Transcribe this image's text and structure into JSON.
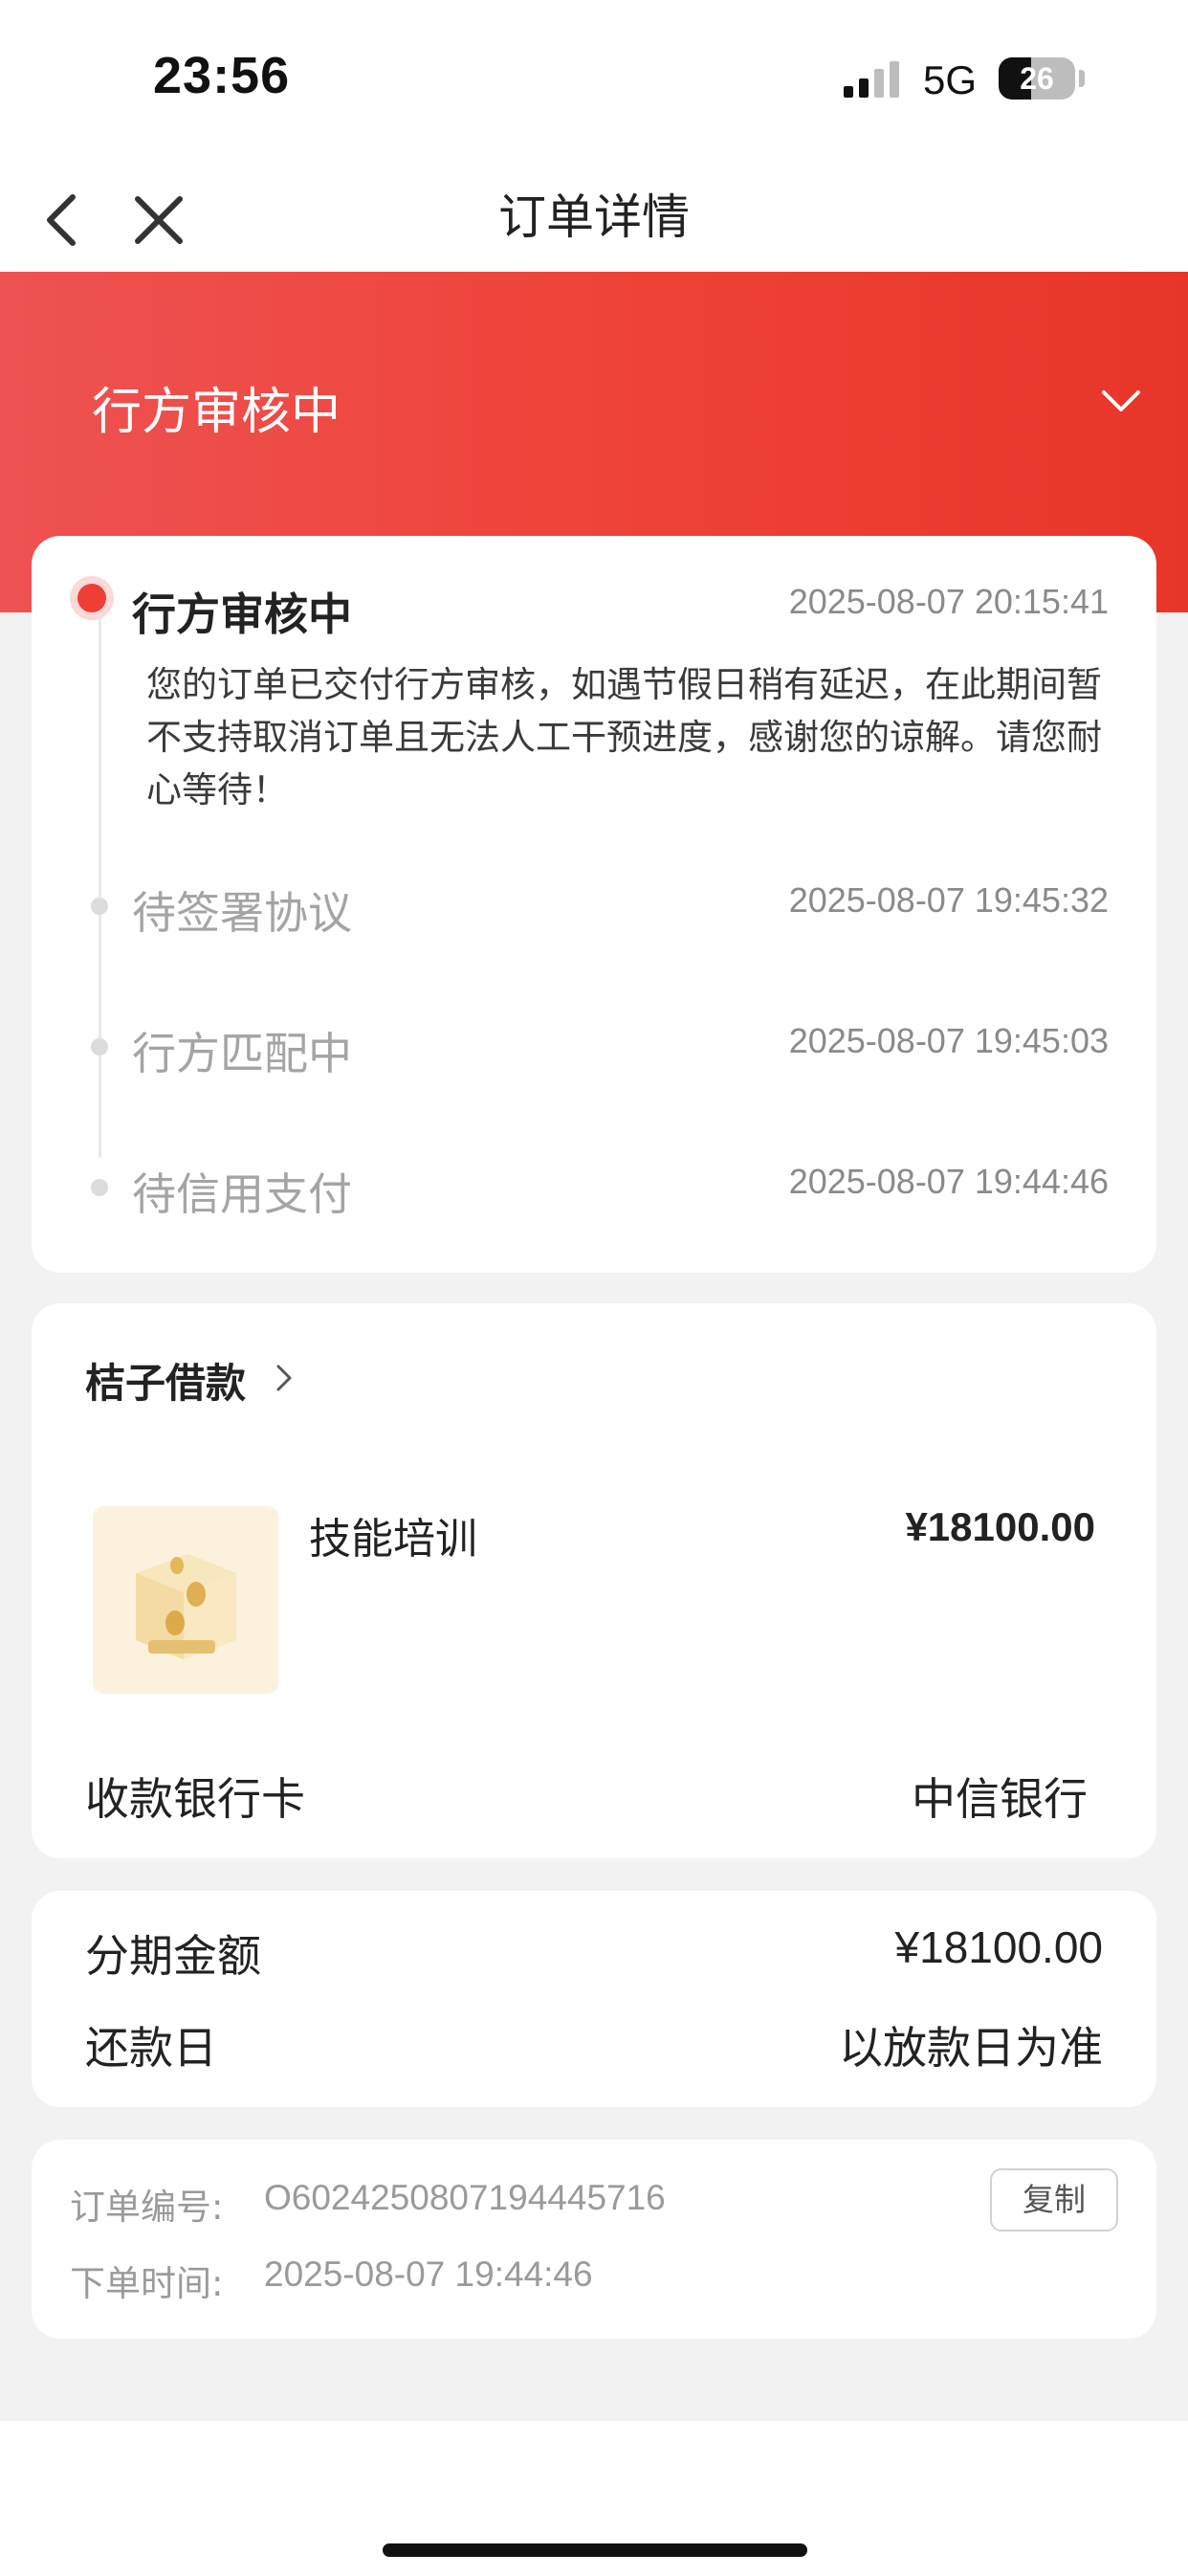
{
  "status_bar": {
    "time": "23:56",
    "network": "5G",
    "battery": "26"
  },
  "nav": {
    "title": "订单详情"
  },
  "banner": {
    "status": "行方审核中"
  },
  "timeline": {
    "steps": [
      {
        "title": "行方审核中",
        "time": "2025-08-07 20:15:41",
        "desc": "您的订单已交付行方审核，如遇节假日稍有延迟，在此期间暂不支持取消订单且无法人工干预进度，感谢您的谅解。请您耐心等待！"
      },
      {
        "title": "待签署协议",
        "time": "2025-08-07 19:45:32"
      },
      {
        "title": "行方匹配中",
        "time": "2025-08-07 19:45:03"
      },
      {
        "title": "待信用支付",
        "time": "2025-08-07 19:44:46"
      }
    ]
  },
  "product": {
    "merchant": "桔子借款",
    "name": "技能培训",
    "price": "¥18100.00",
    "bank_label": "收款银行卡",
    "bank_value": "中信银行"
  },
  "installment": {
    "amount_label": "分期金额",
    "amount_value": "¥18100.00",
    "repay_label": "还款日",
    "repay_value": "以放款日为准"
  },
  "order": {
    "number_label": "订单编号:",
    "number_value": "O6024250807194445716",
    "copy_label": "复制",
    "time_label": "下单时间:",
    "time_value": "2025-08-07 19:44:46"
  }
}
